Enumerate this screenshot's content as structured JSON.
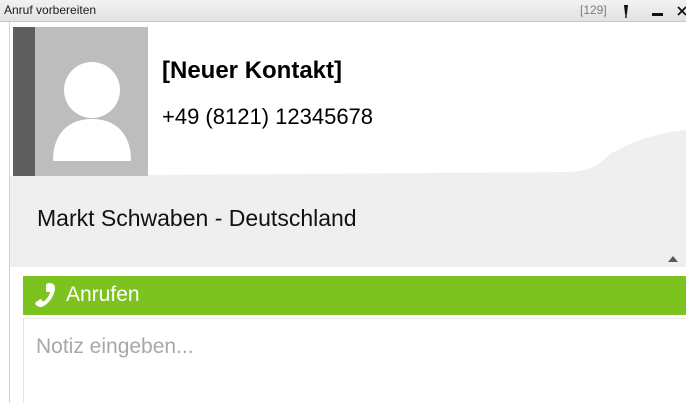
{
  "window": {
    "title": "Anruf vorbereiten",
    "count_badge": "[129]"
  },
  "contact": {
    "name": "[Neuer Kontakt]",
    "phone": "+49 (8121) 12345678",
    "location": "Markt Schwaben - Deutschland"
  },
  "actions": {
    "call_label": "Anrufen"
  },
  "note": {
    "value": "",
    "placeholder": "Notiz eingeben..."
  },
  "icons": {
    "pin": "pin-icon",
    "minimize": "minimize-icon",
    "close": "close-icon",
    "collapse": "chevron-up-icon",
    "phone": "phone-icon",
    "avatar": "avatar-placeholder-icon"
  },
  "colors": {
    "call_green": "#7dc31f",
    "accent_bar": "#5f5f5f",
    "avatar_bg": "#bdbdbd",
    "panel_bg": "#efefef"
  }
}
